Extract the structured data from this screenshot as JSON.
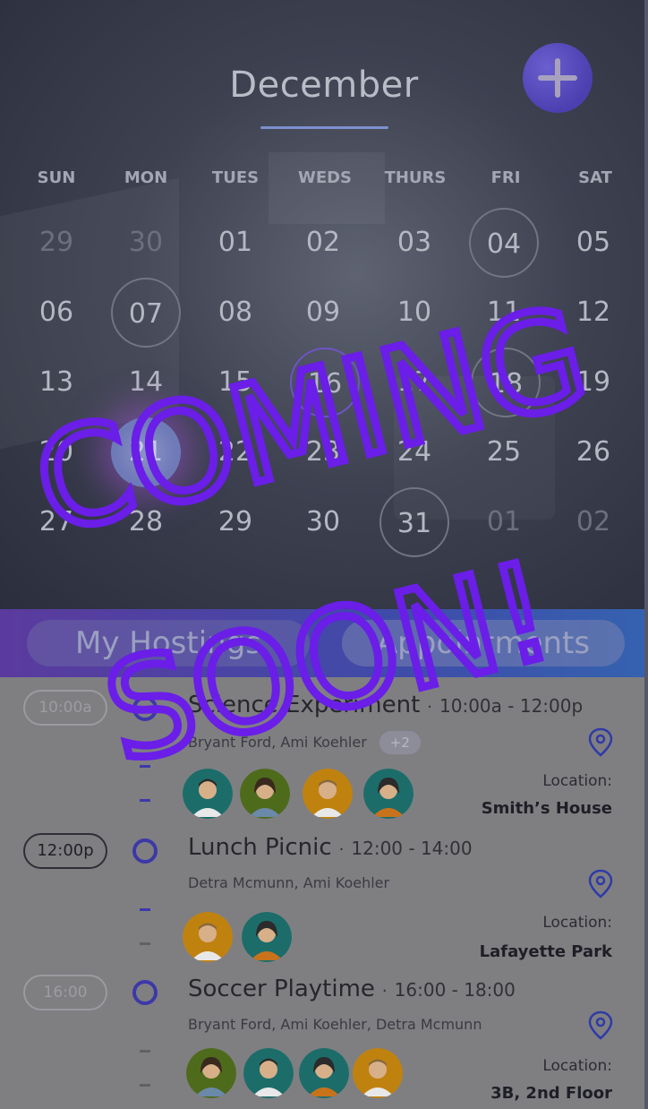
{
  "calendar": {
    "month": "December",
    "add_button_label": "+",
    "weekdays": [
      "SUN",
      "MON",
      "TUES",
      "WEDS",
      "THURS",
      "FRI",
      "SAT"
    ],
    "weeks": [
      [
        "29",
        "30",
        "01",
        "02",
        "03",
        "04",
        "05"
      ],
      [
        "06",
        "07",
        "08",
        "09",
        "10",
        "11",
        "12"
      ],
      [
        "13",
        "14",
        "15",
        "16",
        "17",
        "18",
        "19"
      ],
      [
        "20",
        "21",
        "22",
        "23",
        "24",
        "25",
        "26"
      ],
      [
        "27",
        "28",
        "29",
        "30",
        "31",
        "01",
        "02"
      ]
    ],
    "selected_day": "21"
  },
  "tabs": [
    {
      "label": "My Hostings"
    },
    {
      "label": "Appointments"
    }
  ],
  "events": [
    {
      "time_pill": "10:00a",
      "title": "Science Experiment",
      "range": "10:00a - 12:00p",
      "people": "Bryant Ford, Ami Koehler",
      "extra": "+2",
      "location_label": "Location:",
      "location": "Smith’s House",
      "avatars": [
        "avatar-teal-man",
        "avatar-olive-woman",
        "avatar-orange-man",
        "avatar-teal-woman"
      ]
    },
    {
      "time_pill": "12:00p",
      "title": "Lunch Picnic",
      "range": "12:00 - 14:00",
      "people": "Detra Mcmunn, Ami Koehler",
      "location_label": "Location:",
      "location": "Lafayette Park",
      "avatars": [
        "avatar-orange-man",
        "avatar-teal-woman"
      ]
    },
    {
      "time_pill": "16:00",
      "title": "Soccer Playtime",
      "range": "16:00 - 18:00",
      "people": "Bryant Ford, Ami Koehler, Detra Mcmunn",
      "location_label": "Location:",
      "location": "3B, 2nd Floor",
      "avatars": [
        "avatar-olive-woman",
        "avatar-teal-man",
        "avatar-teal-woman",
        "avatar-orange-man"
      ]
    }
  ],
  "overlay": {
    "line1": "COMING",
    "line2": "SOON!",
    "color": "#6a1ee8"
  }
}
